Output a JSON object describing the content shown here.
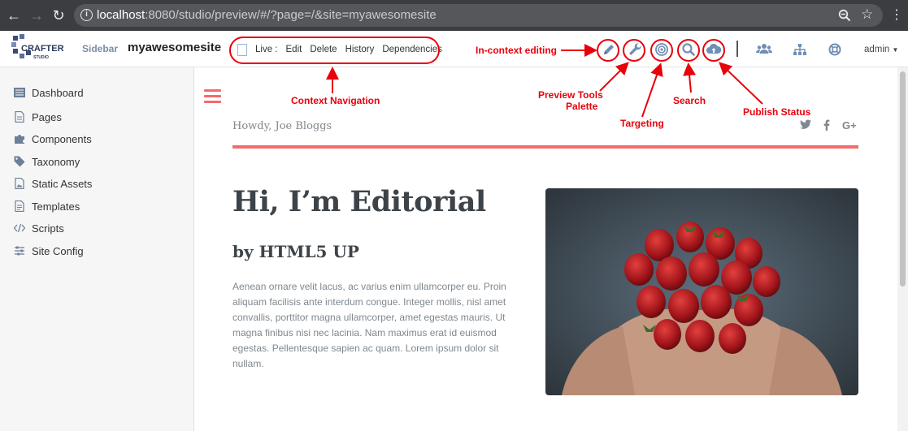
{
  "browser": {
    "url_host": "localhost",
    "url_rest": ":8080/studio/preview/#/?page=/&site=myawesomesite"
  },
  "studio": {
    "logo_text": "CRAFTER",
    "logo_sub": "STUDIO",
    "sidebar_label": "Sidebar",
    "site_name": "myawesomesite",
    "context_nav": [
      "Live :",
      "Edit",
      "Delete",
      "History",
      "Dependencies"
    ],
    "user": "admin"
  },
  "sidebar": {
    "items": [
      {
        "label": "Dashboard",
        "icon": "dashboard-icon"
      },
      {
        "label": "Pages",
        "icon": "page-icon"
      },
      {
        "label": "Components",
        "icon": "puzzle-icon"
      },
      {
        "label": "Taxonomy",
        "icon": "tag-icon"
      },
      {
        "label": "Static Assets",
        "icon": "image-file-icon"
      },
      {
        "label": "Templates",
        "icon": "template-icon"
      },
      {
        "label": "Scripts",
        "icon": "code-icon"
      },
      {
        "label": "Site Config",
        "icon": "sliders-icon"
      }
    ]
  },
  "preview": {
    "greeting": "Howdy, Joe Bloggs",
    "socials": [
      "twitter",
      "facebook",
      "G+"
    ],
    "hero_title": "Hi, I’m Editorial",
    "hero_subtitle": "by HTML5 UP",
    "hero_text": "Aenean ornare velit lacus, ac varius enim ullamcorper eu. Proin aliquam facilisis ante interdum congue. Integer mollis, nisl amet convallis, porttitor magna ullamcorper, amet egestas mauris. Ut magna finibus nisi nec lacinia. Nam maximus erat id euismod egestas. Pellentesque sapien ac quam. Lorem ipsum dolor sit nullam."
  },
  "annotations": {
    "in_context_editing": "In-context editing",
    "context_navigation": "Context Navigation",
    "preview_tools_line1": "Preview Tools",
    "preview_tools_line2": "Palette",
    "targeting": "Targeting",
    "search": "Search",
    "publish_status": "Publish Status"
  },
  "colors": {
    "accent_red": "#f56a6a",
    "annotation_red": "#e8000b",
    "toolbar_icon_blue": "#6f8fb3"
  }
}
